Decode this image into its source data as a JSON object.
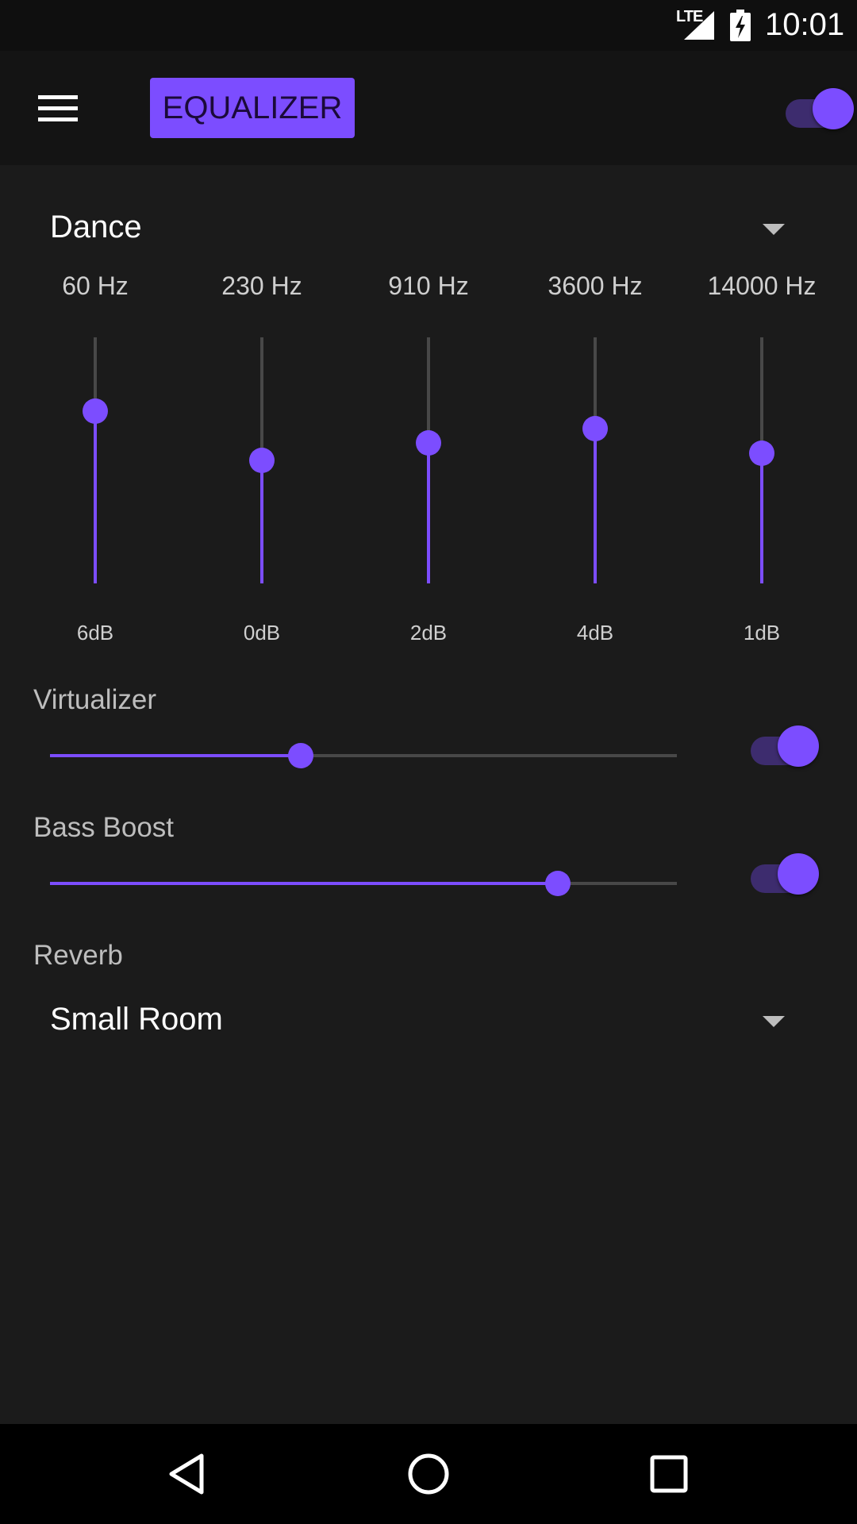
{
  "status_bar": {
    "network": "LTE",
    "time": "10:01"
  },
  "header": {
    "title": "EQUALIZER",
    "master_toggle": {
      "on": true
    }
  },
  "preset": {
    "selected": "Dance"
  },
  "bands": [
    {
      "freq_label": "60 Hz",
      "gain_label": "6dB",
      "level": 0.7
    },
    {
      "freq_label": "230 Hz",
      "gain_label": "0dB",
      "level": 0.5
    },
    {
      "freq_label": "910 Hz",
      "gain_label": "2dB",
      "level": 0.57
    },
    {
      "freq_label": "3600 Hz",
      "gain_label": "4dB",
      "level": 0.63
    },
    {
      "freq_label": "14000 Hz",
      "gain_label": "1dB",
      "level": 0.53
    }
  ],
  "virtualizer": {
    "label": "Virtualizer",
    "level": 0.4,
    "enabled": true
  },
  "bass_boost": {
    "label": "Bass Boost",
    "level": 0.81,
    "enabled": true
  },
  "reverb": {
    "label": "Reverb",
    "selected": "Small Room"
  },
  "colors": {
    "accent": "#7c4dff",
    "accent_track": "#3d2c6e",
    "background": "#1b1b1b",
    "app_bar": "#141414"
  },
  "icons": {
    "menu": "menu-icon",
    "dropdown": "chevron-down-icon",
    "back": "back-icon",
    "home": "home-icon",
    "recents": "recents-icon"
  }
}
